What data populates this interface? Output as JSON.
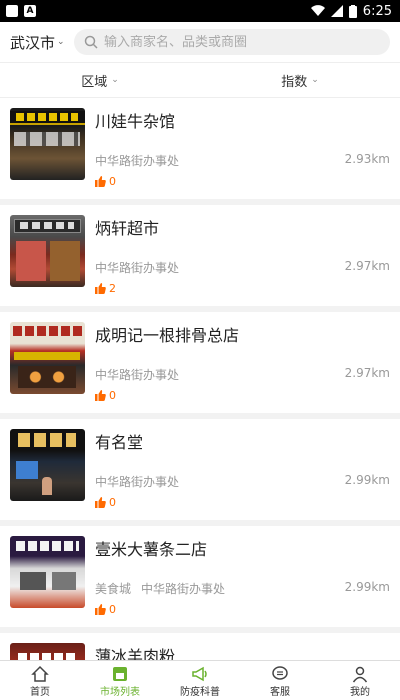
{
  "status_bar": {
    "time": "6:25"
  },
  "header": {
    "city": "武汉市",
    "search_placeholder": "输入商家名、品类或商圈"
  },
  "filters": [
    {
      "label": "区域"
    },
    {
      "label": "指数"
    }
  ],
  "shops": [
    {
      "name": "川娃牛杂馆",
      "tags": [
        "中华路街办事处"
      ],
      "distance": "2.93km",
      "likes": "0"
    },
    {
      "name": "炳轩超市",
      "tags": [
        "中华路街办事处"
      ],
      "distance": "2.97km",
      "likes": "2"
    },
    {
      "name": "成明记一根排骨总店",
      "tags": [
        "中华路街办事处"
      ],
      "distance": "2.97km",
      "likes": "0"
    },
    {
      "name": "有名堂",
      "tags": [
        "中华路街办事处"
      ],
      "distance": "2.99km",
      "likes": "0"
    },
    {
      "name": "壹米大薯条二店",
      "tags": [
        "美食城",
        "中华路街办事处"
      ],
      "distance": "2.99km",
      "likes": "0"
    },
    {
      "name": "薄冰羊肉粉",
      "tags": [],
      "distance": "",
      "likes": ""
    }
  ],
  "tabbar": [
    {
      "label": "首页"
    },
    {
      "label": "市场列表"
    },
    {
      "label": "防疫科普"
    },
    {
      "label": "客服"
    },
    {
      "label": "我的"
    }
  ],
  "colors": {
    "accent": "#6ab22e",
    "like": "#ff6a00"
  }
}
